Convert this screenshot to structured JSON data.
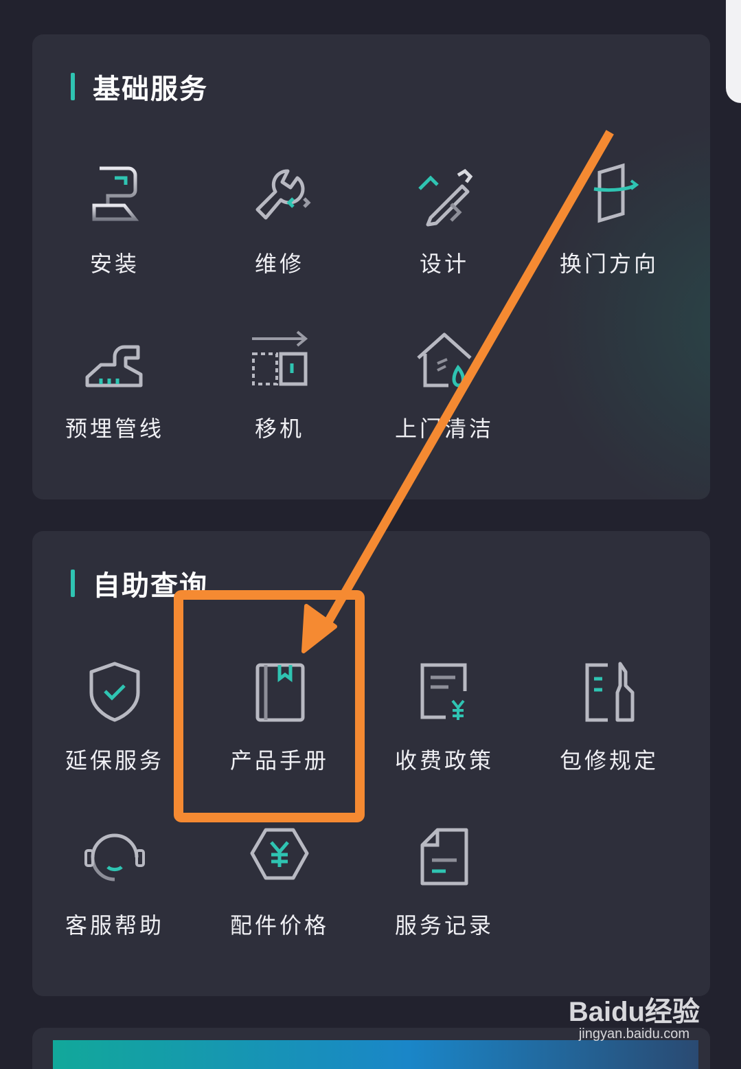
{
  "sections": [
    {
      "title": "基础服务",
      "items": [
        {
          "label": "安装",
          "icon": "install-icon"
        },
        {
          "label": "维修",
          "icon": "wrench-icon"
        },
        {
          "label": "设计",
          "icon": "pencil-ruler-icon"
        },
        {
          "label": "换门方向",
          "icon": "door-rotate-icon"
        },
        {
          "label": "预埋管线",
          "icon": "pipe-icon"
        },
        {
          "label": "移机",
          "icon": "move-machine-icon"
        },
        {
          "label": "上门清洁",
          "icon": "home-clean-icon"
        }
      ]
    },
    {
      "title": "自助查询",
      "items": [
        {
          "label": "延保服务",
          "icon": "shield-check-icon"
        },
        {
          "label": "产品手册",
          "icon": "manual-book-icon"
        },
        {
          "label": "收费政策",
          "icon": "fee-document-icon"
        },
        {
          "label": "包修规定",
          "icon": "warranty-rules-icon"
        },
        {
          "label": "客服帮助",
          "icon": "headset-icon"
        },
        {
          "label": "配件价格",
          "icon": "parts-price-icon"
        },
        {
          "label": "服务记录",
          "icon": "service-record-icon"
        }
      ]
    }
  ],
  "annotation": {
    "highlight_color": "#f58a32"
  },
  "accent_color": "#2fc4b2",
  "watermark": {
    "brand": "Baidu经验",
    "url": "jingyan.baidu.com"
  }
}
